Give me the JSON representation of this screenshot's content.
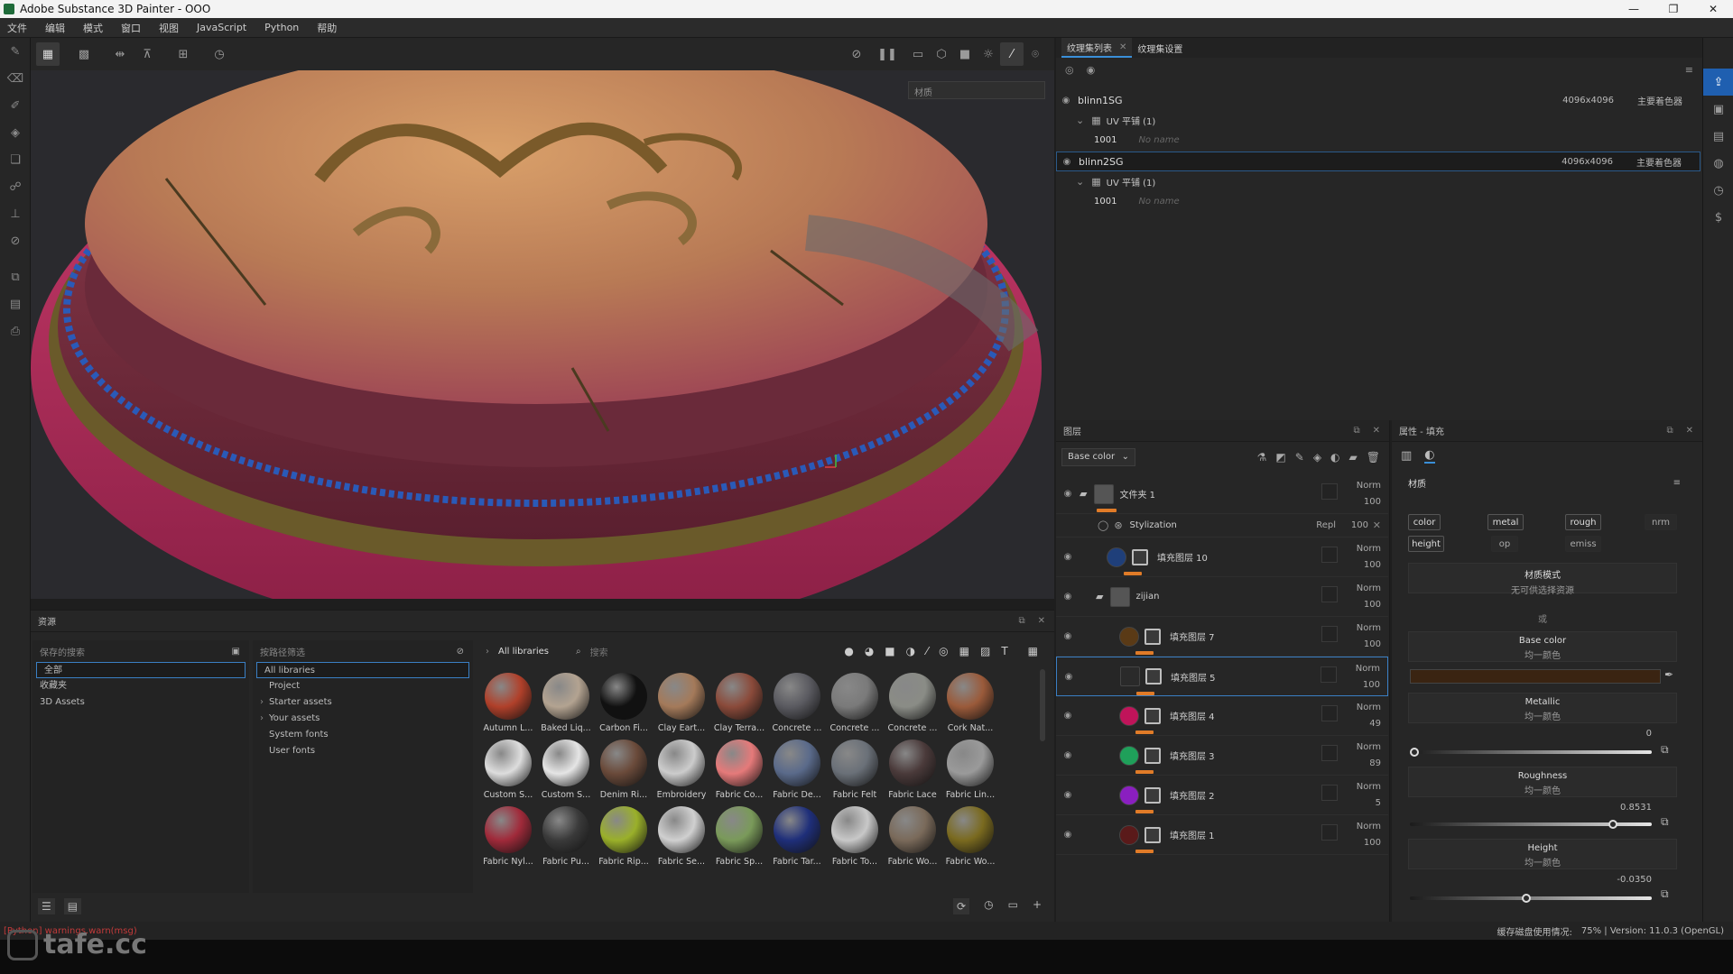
{
  "window": {
    "title": "Adobe Substance 3D Painter - OOO",
    "controls": [
      "—",
      "❐",
      "✕"
    ]
  },
  "menu": [
    "文件",
    "编辑",
    "模式",
    "窗口",
    "视图",
    "JavaScript",
    "Python",
    "帮助"
  ],
  "viewport": {
    "material_dropdown": "材质"
  },
  "texture_sets": {
    "tabs": [
      "纹理集列表",
      "纹理集设置"
    ],
    "rows": [
      {
        "name": "blinn1SG",
        "size": "4096x4096",
        "shader": "主要着色器"
      },
      {
        "uv": "UV 平铺 (1)",
        "tile": "1001",
        "tile_name": "No name"
      },
      {
        "name": "blinn2SG",
        "size": "4096x4096",
        "shader": "主要着色器"
      },
      {
        "uv": "UV 平铺 (1)",
        "tile": "1001",
        "tile_name": "No name"
      }
    ]
  },
  "layers": {
    "title": "图层",
    "channel": "Base color",
    "rows": [
      {
        "name": "文件夹 1",
        "blend": "Norm",
        "opacity": "100",
        "thumb": "#555555"
      },
      {
        "name": "Stylization",
        "blend": "Repl",
        "opacity": "100"
      },
      {
        "name": "填充图层 10",
        "blend": "Norm",
        "opacity": "100",
        "thumb": "#1f3f7a"
      },
      {
        "name": "zijian",
        "blend": "Norm",
        "opacity": "100",
        "thumb": "#555555"
      },
      {
        "name": "填充图层 7",
        "blend": "Norm",
        "opacity": "100",
        "thumb": "#5a3a16"
      },
      {
        "name": "填充图层 5",
        "blend": "Norm",
        "opacity": "100",
        "thumb": "#2a2a2a"
      },
      {
        "name": "填充图层 4",
        "blend": "Norm",
        "opacity": "49",
        "thumb": "#c0145a"
      },
      {
        "name": "填充图层 3",
        "blend": "Norm",
        "opacity": "89",
        "thumb": "#1fa05a"
      },
      {
        "name": "填充图层 2",
        "blend": "Norm",
        "opacity": "5",
        "thumb": "#8a1fc0"
      },
      {
        "name": "填充图层 1",
        "blend": "Norm",
        "opacity": "100",
        "thumb": "#5a1a1a"
      }
    ]
  },
  "properties": {
    "title": "属性 - 填充",
    "section": "材质",
    "channels": [
      "color",
      "metal",
      "rough",
      "nrm",
      "height",
      "op",
      "emiss"
    ],
    "mode_title": "材质模式",
    "mode_sub": "无可供选择资源",
    "or": "或",
    "base_color": {
      "title": "Base color",
      "sub": "均一颜色",
      "swatch": "#3a2412"
    },
    "metallic": {
      "title": "Metallic",
      "sub": "均一颜色",
      "value": "0",
      "fraction": 0.0
    },
    "roughness": {
      "title": "Roughness",
      "sub": "均一颜色",
      "value": "0.8531",
      "fraction": 0.8531
    },
    "height": {
      "title": "Height",
      "sub": "均一颜色",
      "value": "-0.0350",
      "fraction": 0.48
    }
  },
  "resources": {
    "title": "资源",
    "saved_search": "保存的搜索",
    "nav": [
      "全部",
      "收藏夹",
      "3D Assets"
    ],
    "lib_header": "按路径筛选",
    "libs": [
      "All libraries",
      "Project",
      "Starter assets",
      "Your assets",
      "System fonts",
      "User fonts"
    ],
    "current_lib": "All libraries",
    "search_placeholder": "搜索",
    "materials": [
      {
        "label": "Autumn L...",
        "color": "#b0402a"
      },
      {
        "label": "Baked Liq...",
        "color": "#b3a391"
      },
      {
        "label": "Carbon Fi...",
        "color": "#111111"
      },
      {
        "label": "Clay Eart...",
        "color": "#a47a5a"
      },
      {
        "label": "Clay Terra...",
        "color": "#8a4a3a"
      },
      {
        "label": "Concrete ...",
        "color": "#5a5a60"
      },
      {
        "label": "Concrete ...",
        "color": "#7a7a7a"
      },
      {
        "label": "Concrete ...",
        "color": "#8a8c86"
      },
      {
        "label": "Cork Nat...",
        "color": "#9a5a3a"
      },
      {
        "label": "Custom S...",
        "color": "#dddddd"
      },
      {
        "label": "Custom S...",
        "color": "#e5e5e5"
      },
      {
        "label": "Denim Ri...",
        "color": "#6a4a3a"
      },
      {
        "label": "Embroidery",
        "color": "#cccccc"
      },
      {
        "label": "Fabric Co...",
        "color": "#e57a7a"
      },
      {
        "label": "Fabric De...",
        "color": "#5a6a8a"
      },
      {
        "label": "Fabric Felt",
        "color": "#6a7078"
      },
      {
        "label": "Fabric Lace",
        "color": "#4a3a3a"
      },
      {
        "label": "Fabric Lin...",
        "color": "#9a9a9a"
      },
      {
        "label": "Fabric Nyl...",
        "color": "#a02a3a"
      },
      {
        "label": "Fabric Pu...",
        "color": "#3a3a3a"
      },
      {
        "label": "Fabric Rip...",
        "color": "#9ab02a"
      },
      {
        "label": "Fabric Se...",
        "color": "#d0d0d0"
      },
      {
        "label": "Fabric Sp...",
        "color": "#7a9a5a"
      },
      {
        "label": "Fabric Tar...",
        "color": "#1f2f7a"
      },
      {
        "label": "Fabric To...",
        "color": "#c8c8c8"
      },
      {
        "label": "Fabric Wo...",
        "color": "#7a6a5a"
      },
      {
        "label": "Fabric Wo...",
        "color": "#7a6a1f"
      }
    ]
  },
  "status": {
    "left": "[Python] warnings.warn(msg)",
    "cache": "缓存磁盘使用情况:",
    "info": "75% | Version: 11.0.3 (OpenGL)"
  },
  "watermark": "tafe.cc"
}
